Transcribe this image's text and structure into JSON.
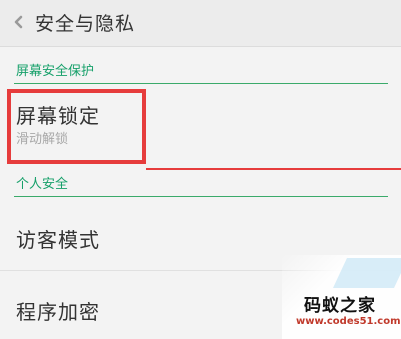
{
  "header": {
    "title": "安全与隐私",
    "back_icon": "chevron-left-icon"
  },
  "sections": [
    {
      "title": "屏幕安全保护",
      "items": [
        {
          "title": "屏幕锁定",
          "subtitle": "滑动解锁"
        }
      ]
    },
    {
      "title": "个人安全",
      "items": [
        {
          "title": "访客模式"
        },
        {
          "title": "程序加密"
        }
      ]
    }
  ],
  "watermark": {
    "name": "码蚁之家",
    "url": "www.codes51.com"
  },
  "colors": {
    "accent_green": "#16a06a",
    "highlight_red": "#e63c3c"
  }
}
